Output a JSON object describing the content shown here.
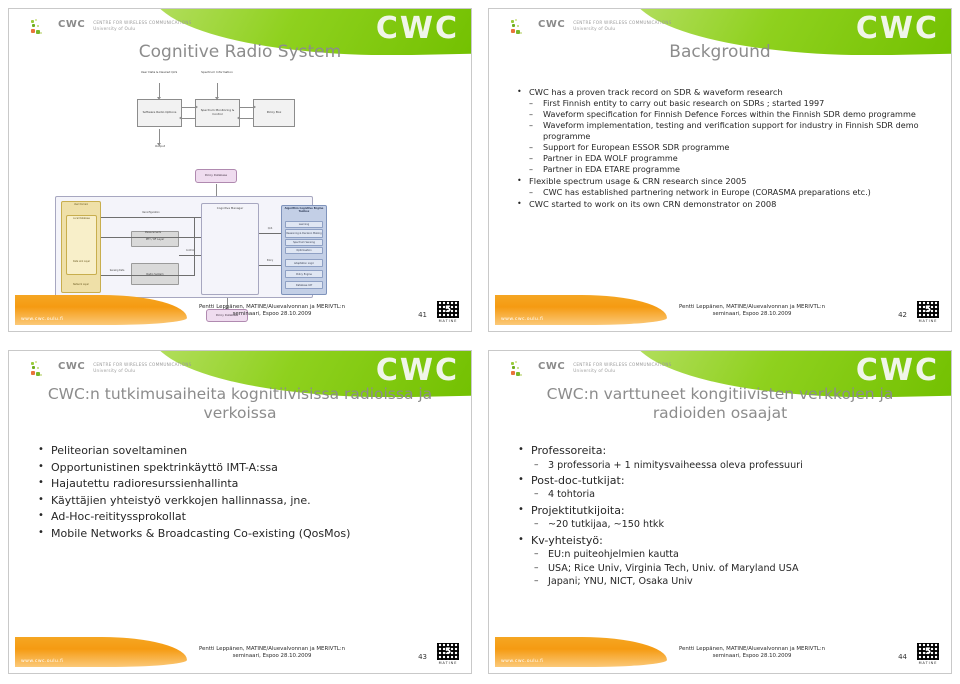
{
  "document": {
    "type": "presentation-handout",
    "slides_per_page": 4
  },
  "brand": {
    "logo_acronym": "CWC",
    "logo_line1": "CENTRE FOR WIRELESS COMMUNICATIONS",
    "logo_line2": "University of Oulu",
    "ghost_watermark": "CWC",
    "green": "#8fd11e",
    "orange": "#f5a623",
    "title_gray": "#8c8c8c"
  },
  "footer": {
    "url": "www.cwc.oulu.fi",
    "credit_line1": "Pentti Leppänen, MATINE/Aluevalvonnan ja MERIVTL:n",
    "credit_line2": "seminaari, Espoo 28.10.2009",
    "qr_caption": "MATINE"
  },
  "slides": [
    {
      "number": "41",
      "title": "Cognitive Radio System",
      "diagram": {
        "label_user_data": "User Data & Desired QoS",
        "label_spectrum_info": "Spectrum Information",
        "label_output": "Output",
        "box_software_radio": "Software Radio Options",
        "box_spectrum_monitoring": "Spectrum Monitoring & Control",
        "box_policy": "Policy Box",
        "pill_policy_database_top": "Policy Database",
        "pill_policy_database_bottom": "Policy Database",
        "box_cognitive_manager": "Cognitive Manager",
        "box_radio_system": "Radio System",
        "box_local_database": "Local Database",
        "box_network_layer": "Network Layer",
        "box_user_domain": "User Domain",
        "box_data_link": "Data Link Layer",
        "box_phy": "PHY / RF Layer",
        "panel_title": "Algorithm Cognitive Engine Toolbox",
        "panel_items": [
          "Learning",
          "Reasoning & Decision Making",
          "Spectrum Sensing",
          "Optimisation",
          "Adaptation Logic",
          "Policy Engine",
          "Database Intf"
        ],
        "edge_labels": [
          "Reconfiguration",
          "Measurements",
          "Control",
          "Sensing Data",
          "QoS",
          "Policy",
          "Status"
        ]
      }
    },
    {
      "number": "42",
      "title": "Background",
      "bullets": [
        {
          "level": 1,
          "text": "CWC has a proven track record on SDR & waveform research",
          "children": [
            "First Finnish entity to carry out basic research on SDRs ; started 1997",
            "Waveform specification for Finnish Defence Forces within the Finnish SDR demo programme",
            "Waveform implementation, testing and verification  support for industry in Finnish SDR demo programme",
            "Support for European ESSOR SDR programme",
            "Partner in EDA WOLF programme",
            "Partner in EDA ETARE programme"
          ]
        },
        {
          "level": 1,
          "text": "Flexible spectrum usage & CRN research since 2005",
          "children": [
            "CWC has established partnering network in Europe (CORASMA preparations etc.)"
          ]
        },
        {
          "level": 1,
          "text": "CWC started to work on its own CRN demonstrator on 2008",
          "children": []
        }
      ]
    },
    {
      "number": "43",
      "title": "CWC:n tutkimusaiheita kognitiivisissa radioissa ja verkoissa",
      "bullets": [
        {
          "level": 1,
          "text": "Peliteorian soveltaminen",
          "children": []
        },
        {
          "level": 1,
          "text": "Opportunistinen spektrinkäyttö IMT-A:ssa",
          "children": []
        },
        {
          "level": 1,
          "text": "Hajautettu radioresurssienhallinta",
          "children": []
        },
        {
          "level": 1,
          "text": "Käyttäjien yhteistyö verkkojen hallinnassa, jne.",
          "children": []
        },
        {
          "level": 1,
          "text": "Ad-Hoc-reitityssprokollat",
          "children": []
        },
        {
          "level": 1,
          "text": "Mobile Networks & Broadcasting Co-existing (QosMos)",
          "children": []
        }
      ]
    },
    {
      "number": "44",
      "title": "CWC:n varttuneet kongitiivisten verkkojen ja radioiden osaajat",
      "bullets": [
        {
          "level": 1,
          "text": "Professoreita:",
          "children": [
            "3 professoria + 1 nimitysvaiheessa oleva professuuri"
          ]
        },
        {
          "level": 1,
          "text": "Post-doc-tutkijat:",
          "children": [
            "4 tohtoria"
          ]
        },
        {
          "level": 1,
          "text": "Projektitutkijoita:",
          "children": [
            "~20 tutkijaa, ~150 htkk"
          ]
        },
        {
          "level": 1,
          "text": "Kv-yhteistyö:",
          "children": [
            "EU:n puiteohjelmien kautta",
            "USA; Rice Univ, Virginia Tech, Univ. of Maryland USA",
            "Japani; YNU, NICT, Osaka Univ"
          ]
        }
      ]
    }
  ]
}
